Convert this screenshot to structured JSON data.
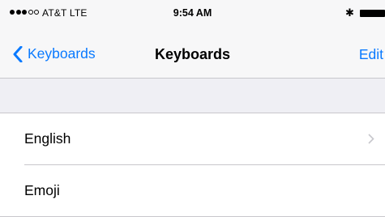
{
  "status_bar": {
    "signal_dots": [
      true,
      true,
      true,
      false,
      false
    ],
    "carrier": "AT&T  LTE",
    "time": "9:54 AM",
    "bluetooth_icon": "bluetooth-icon",
    "battery_icon": "battery-icon"
  },
  "nav": {
    "back_label": "Keyboards",
    "title": "Keyboards",
    "edit_label": "Edit"
  },
  "keyboards": {
    "items": [
      {
        "label": "English",
        "chevron": true
      },
      {
        "label": "Emoji",
        "chevron": false
      }
    ]
  },
  "colors": {
    "accent": "#0a7aff",
    "background": "#efeff4",
    "separator": "#c8c7cc"
  }
}
